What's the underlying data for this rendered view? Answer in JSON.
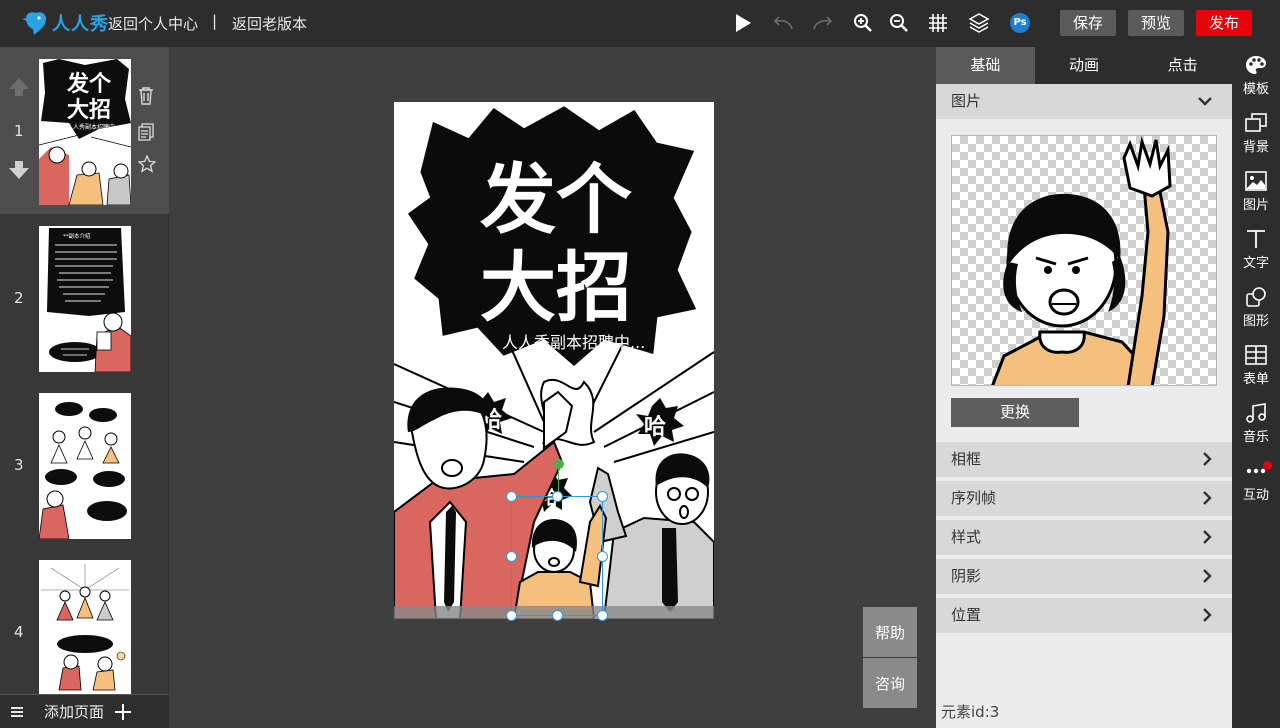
{
  "header": {
    "logo_text": "人人秀",
    "back_center": "返回个人中心",
    "separator": "|",
    "back_old": "返回老版本",
    "save": "保存",
    "preview": "预览",
    "publish": "发布",
    "ps_label": "Ps"
  },
  "pages": {
    "items": [
      {
        "num": "1"
      },
      {
        "num": "2"
      },
      {
        "num": "3"
      },
      {
        "num": "4"
      }
    ],
    "add_page": "添加页面"
  },
  "poster": {
    "title_line1": "发个",
    "title_line2": "大招",
    "subtitle": "人人秀副本招聘中...",
    "bubble1": "哈",
    "bubble2": "哈",
    "bubble3": "哈"
  },
  "thumb2": {
    "title": "**副本介绍",
    "footer": "我们 在等你的到来 / 下面是具体描述"
  },
  "help": "帮助",
  "consult": "咨询",
  "props": {
    "tabs": [
      {
        "label": "基础",
        "active": true
      },
      {
        "label": "动画",
        "active": false
      },
      {
        "label": "点击",
        "active": false
      }
    ],
    "image_section": "图片",
    "replace": "更换",
    "sections": [
      "相框",
      "序列帧",
      "样式",
      "阴影",
      "位置"
    ],
    "element_id": "元素id:3"
  },
  "right_tools": [
    {
      "label": "模板",
      "icon": "palette-icon"
    },
    {
      "label": "背景",
      "icon": "background-icon"
    },
    {
      "label": "图片",
      "icon": "image-icon"
    },
    {
      "label": "文字",
      "icon": "text-icon"
    },
    {
      "label": "图形",
      "icon": "shape-icon"
    },
    {
      "label": "表单",
      "icon": "form-icon"
    },
    {
      "label": "音乐",
      "icon": "music-icon"
    },
    {
      "label": "互动",
      "icon": "more-dots-icon"
    }
  ],
  "colors": {
    "brand": "#27a4e6",
    "publish": "#e8000b",
    "accent_red": "#d9675f",
    "accent_orange": "#f5c07e",
    "selection": "#2c9adf"
  }
}
